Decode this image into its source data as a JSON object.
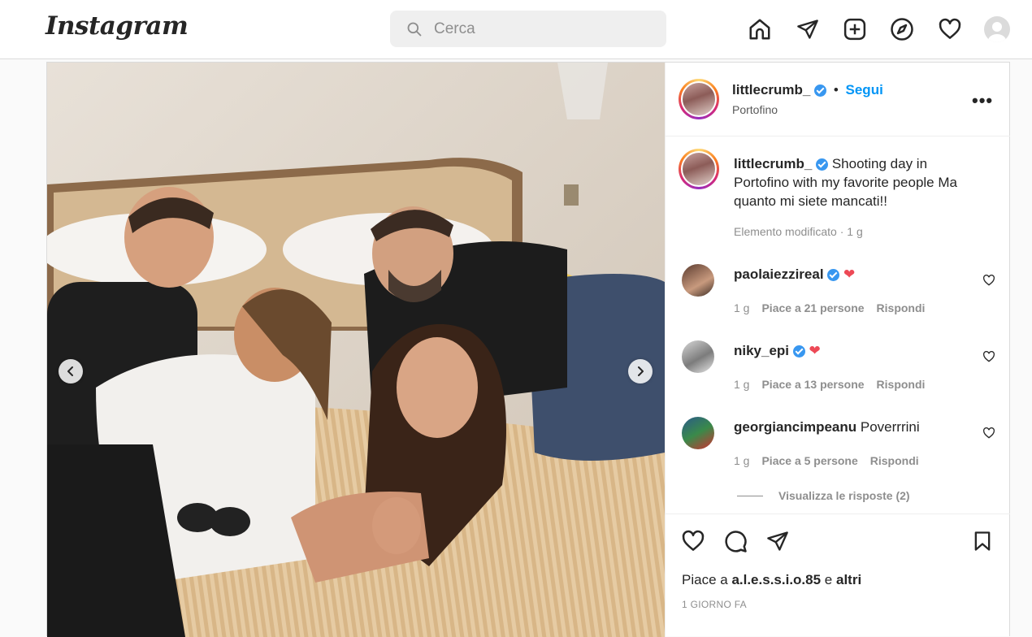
{
  "app": {
    "logo": "Instagram",
    "search_placeholder": "Cerca"
  },
  "nav": {
    "icons": [
      "home-icon",
      "direct-icon",
      "new-post-icon",
      "explore-icon",
      "activity-icon",
      "profile-icon"
    ]
  },
  "post": {
    "username": "littlecrumb_",
    "separator": "•",
    "follow_label": "Segui",
    "location": "Portofino",
    "more_label": "•••",
    "caption_user": "littlecrumb_",
    "caption_text": "Shooting day in Portofino with my favorite people Ma quanto mi siete mancati!!",
    "caption_meta": "Elemento modificato · 1 g",
    "comments": [
      {
        "user": "paolaiezzireal",
        "verified": true,
        "text": "❤",
        "age": "1 g",
        "likes": "Piace a 21 persone",
        "reply": "Rispondi"
      },
      {
        "user": "niky_epi",
        "verified": true,
        "text": "❤",
        "age": "1 g",
        "likes": "Piace a 13 persone",
        "reply": "Rispondi"
      },
      {
        "user": "georgiancimpeanu",
        "verified": false,
        "text": "Poverrrini",
        "age": "1 g",
        "likes": "Piace a 5 persone",
        "reply": "Rispondi"
      }
    ],
    "view_replies": "Visualizza le risposte (2)",
    "likes_prefix": "Piace a",
    "likes_user": "a.l.e.s.s.i.o.85",
    "likes_and": "e",
    "likes_others": "altri",
    "time_ago": "1 GIORNO FA"
  },
  "colors": {
    "accent": "#0095f6",
    "verified": "#3897f0",
    "heart": "#ed4956"
  }
}
